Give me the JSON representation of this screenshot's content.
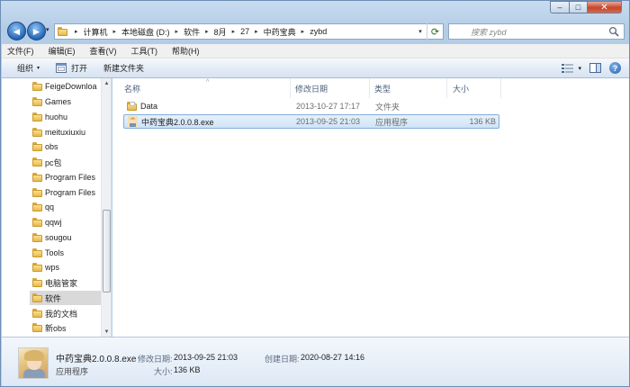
{
  "window": {
    "controls": {
      "minimize": "–",
      "maximize": "□",
      "close": "✕"
    }
  },
  "nav": {
    "back": "◄",
    "forward": "►",
    "history": "▾"
  },
  "address": {
    "crumbs": [
      "计算机",
      "本地磁盘 (D:)",
      "软件",
      "8月",
      "27",
      "中药宝典",
      "zybd"
    ],
    "separator": "▸",
    "dropdown": "▾",
    "refresh": "⟳"
  },
  "search": {
    "placeholder": "搜索 zybd"
  },
  "menu": {
    "file": "文件(F)",
    "edit": "编辑(E)",
    "view": "查看(V)",
    "tools": "工具(T)",
    "help": "帮助(H)"
  },
  "toolbar": {
    "organize": "组织",
    "open": "打开",
    "new_folder": "新建文件夹",
    "caret": "▾",
    "help": "?"
  },
  "tree": {
    "items": [
      "FeigeDownloa",
      "Games",
      "huohu",
      "meituxiuxiu",
      "obs",
      "pc包",
      "Program Files",
      "Program Files",
      "qq",
      "qqwj",
      "sougou",
      "Tools",
      "wps",
      "电脑管家",
      "软件",
      "我的文档",
      "新obs"
    ],
    "scroll_up": "▲",
    "scroll_down": "▼"
  },
  "columns": {
    "name": "名称",
    "modified": "修改日期",
    "type": "类型",
    "size": "大小",
    "sort_indicator": "^"
  },
  "files": [
    {
      "name": "Data",
      "modified": "2013-10-27 17:17",
      "type": "文件夹",
      "size": ""
    },
    {
      "name": "中药宝典2.0.0.8.exe",
      "modified": "2013-09-25 21:03",
      "type": "应用程序",
      "size": "136 KB"
    }
  ],
  "details": {
    "name": "中药宝典2.0.0.8.exe",
    "type": "应用程序",
    "modified_label": "修改日期:",
    "modified": "2013-09-25 21:03",
    "created_label": "创建日期:",
    "created": "2020-08-27 14:16",
    "size_label": "大小:",
    "size": "136 KB"
  }
}
